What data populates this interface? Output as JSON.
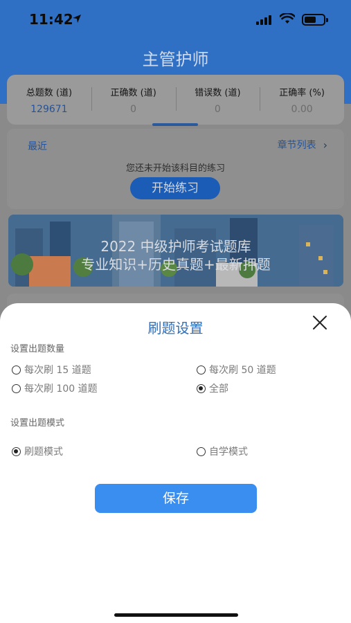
{
  "status": {
    "time": "11:42"
  },
  "header": {
    "title": "主管护师"
  },
  "stats": [
    {
      "label": "总题数 (道)",
      "value": "129671"
    },
    {
      "label": "正确数 (道)",
      "value": "0"
    },
    {
      "label": "错误数 (道)",
      "value": "0"
    },
    {
      "label": "正确率 (%)",
      "value": "0.00"
    }
  ],
  "practice": {
    "recent_label": "最近",
    "chapter_link": "章节列表",
    "empty_message": "您还未开始该科目的练习",
    "start_button": "开始练习"
  },
  "banner": {
    "line1": "2022 中级护师考试题库",
    "line2": "专业知识+历史真题+最新押题"
  },
  "sheet": {
    "title": "刷题设置",
    "count_section": "设置出题数量",
    "count_options": [
      {
        "label": "每次刷 15 道题",
        "selected": false
      },
      {
        "label": "每次刷 50 道题",
        "selected": false
      },
      {
        "label": "每次刷 100 道题",
        "selected": false
      },
      {
        "label": "全部",
        "selected": true
      }
    ],
    "mode_section": "设置出题模式",
    "mode_options": [
      {
        "label": "刷题模式",
        "selected": true
      },
      {
        "label": "自学模式",
        "selected": false
      }
    ],
    "save_button": "保存"
  },
  "colors": {
    "accent": "#2d6fbf",
    "save_button": "#3a8ef0",
    "header": "#2f6fc4"
  }
}
